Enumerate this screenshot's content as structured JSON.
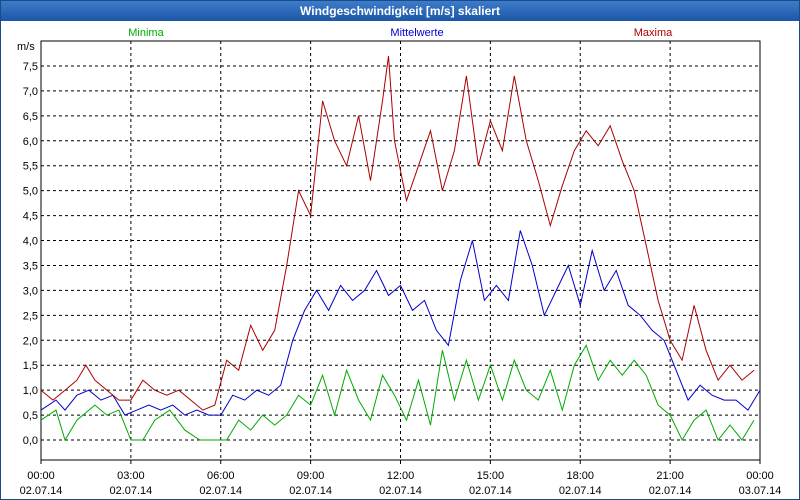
{
  "window": {
    "title": "Windgeschwindigkeit [m/s] skaliert"
  },
  "chart_data": {
    "type": "line",
    "title": "Windgeschwindigkeit [m/s] skaliert",
    "ylabel": "m/s",
    "ylim": [
      -0.4,
      8.0
    ],
    "xlim": [
      0,
      24
    ],
    "grid": true,
    "legend": "top",
    "y_ticks": [
      "0,0",
      "0,5",
      "1,0",
      "1,5",
      "2,0",
      "2,5",
      "3,0",
      "3,5",
      "4,0",
      "4,5",
      "5,0",
      "5,5",
      "6,0",
      "6,5",
      "7,0",
      "7,5"
    ],
    "x_tick_times": [
      "00:00",
      "03:00",
      "06:00",
      "09:00",
      "12:00",
      "15:00",
      "18:00",
      "21:00",
      "00:00"
    ],
    "x_tick_dates": [
      "02.07.14",
      "02.07.14",
      "02.07.14",
      "02.07.14",
      "02.07.14",
      "02.07.14",
      "02.07.14",
      "02.07.14",
      "03.07.14"
    ],
    "series": [
      {
        "name": "Minima",
        "color": "#00aa00",
        "points": [
          [
            0,
            0.4
          ],
          [
            0.5,
            0.6
          ],
          [
            0.8,
            0.0
          ],
          [
            1.2,
            0.4
          ],
          [
            1.8,
            0.7
          ],
          [
            2.2,
            0.5
          ],
          [
            2.6,
            0.6
          ],
          [
            3.0,
            0.0
          ],
          [
            3.4,
            0.0
          ],
          [
            3.8,
            0.4
          ],
          [
            4.3,
            0.6
          ],
          [
            4.8,
            0.2
          ],
          [
            5.3,
            0.0
          ],
          [
            5.8,
            0.0
          ],
          [
            6.2,
            0.0
          ],
          [
            6.6,
            0.4
          ],
          [
            7.0,
            0.2
          ],
          [
            7.4,
            0.5
          ],
          [
            7.8,
            0.3
          ],
          [
            8.2,
            0.5
          ],
          [
            8.6,
            0.9
          ],
          [
            9.0,
            0.7
          ],
          [
            9.4,
            1.3
          ],
          [
            9.8,
            0.5
          ],
          [
            10.2,
            1.4
          ],
          [
            10.6,
            0.8
          ],
          [
            11.0,
            0.4
          ],
          [
            11.4,
            1.3
          ],
          [
            11.8,
            0.9
          ],
          [
            12.2,
            0.4
          ],
          [
            12.6,
            1.2
          ],
          [
            13.0,
            0.3
          ],
          [
            13.4,
            1.8
          ],
          [
            13.8,
            0.8
          ],
          [
            14.2,
            1.6
          ],
          [
            14.6,
            0.8
          ],
          [
            15.0,
            1.5
          ],
          [
            15.4,
            0.8
          ],
          [
            15.8,
            1.6
          ],
          [
            16.2,
            1.0
          ],
          [
            16.6,
            0.8
          ],
          [
            17.0,
            1.4
          ],
          [
            17.4,
            0.6
          ],
          [
            17.8,
            1.5
          ],
          [
            18.2,
            1.9
          ],
          [
            18.6,
            1.2
          ],
          [
            19.0,
            1.6
          ],
          [
            19.4,
            1.3
          ],
          [
            19.8,
            1.6
          ],
          [
            20.2,
            1.3
          ],
          [
            20.6,
            0.7
          ],
          [
            21.0,
            0.5
          ],
          [
            21.4,
            0.0
          ],
          [
            21.8,
            0.4
          ],
          [
            22.2,
            0.6
          ],
          [
            22.6,
            0.0
          ],
          [
            23.0,
            0.3
          ],
          [
            23.4,
            0.0
          ],
          [
            23.8,
            0.4
          ]
        ]
      },
      {
        "name": "Mittelwerte",
        "color": "#0000cc",
        "points": [
          [
            0,
            0.6
          ],
          [
            0.5,
            0.8
          ],
          [
            0.8,
            0.6
          ],
          [
            1.2,
            0.9
          ],
          [
            1.6,
            1.0
          ],
          [
            2.0,
            0.8
          ],
          [
            2.4,
            0.9
          ],
          [
            2.8,
            0.5
          ],
          [
            3.2,
            0.6
          ],
          [
            3.6,
            0.7
          ],
          [
            4.0,
            0.6
          ],
          [
            4.4,
            0.7
          ],
          [
            4.8,
            0.5
          ],
          [
            5.2,
            0.6
          ],
          [
            5.6,
            0.5
          ],
          [
            6.0,
            0.5
          ],
          [
            6.4,
            0.9
          ],
          [
            6.8,
            0.8
          ],
          [
            7.2,
            1.0
          ],
          [
            7.6,
            0.9
          ],
          [
            8.0,
            1.1
          ],
          [
            8.4,
            2.0
          ],
          [
            8.8,
            2.6
          ],
          [
            9.2,
            3.0
          ],
          [
            9.6,
            2.6
          ],
          [
            10.0,
            3.1
          ],
          [
            10.4,
            2.8
          ],
          [
            10.8,
            3.0
          ],
          [
            11.2,
            3.4
          ],
          [
            11.6,
            2.9
          ],
          [
            12.0,
            3.1
          ],
          [
            12.4,
            2.6
          ],
          [
            12.8,
            2.8
          ],
          [
            13.2,
            2.2
          ],
          [
            13.6,
            1.9
          ],
          [
            14.0,
            3.2
          ],
          [
            14.4,
            4.0
          ],
          [
            14.8,
            2.8
          ],
          [
            15.2,
            3.1
          ],
          [
            15.6,
            2.8
          ],
          [
            16.0,
            4.2
          ],
          [
            16.4,
            3.5
          ],
          [
            16.8,
            2.5
          ],
          [
            17.2,
            3.0
          ],
          [
            17.6,
            3.5
          ],
          [
            18.0,
            2.7
          ],
          [
            18.4,
            3.8
          ],
          [
            18.8,
            3.0
          ],
          [
            19.2,
            3.4
          ],
          [
            19.6,
            2.7
          ],
          [
            20.0,
            2.5
          ],
          [
            20.4,
            2.2
          ],
          [
            20.8,
            2.0
          ],
          [
            21.2,
            1.4
          ],
          [
            21.6,
            0.8
          ],
          [
            22.0,
            1.1
          ],
          [
            22.4,
            0.9
          ],
          [
            22.8,
            0.8
          ],
          [
            23.2,
            0.8
          ],
          [
            23.6,
            0.6
          ],
          [
            24.0,
            1.0
          ]
        ]
      },
      {
        "name": "Maxima",
        "color": "#aa0000",
        "points": [
          [
            0,
            1.0
          ],
          [
            0.4,
            0.8
          ],
          [
            0.8,
            1.0
          ],
          [
            1.2,
            1.2
          ],
          [
            1.5,
            1.5
          ],
          [
            1.8,
            1.2
          ],
          [
            2.2,
            1.0
          ],
          [
            2.6,
            0.8
          ],
          [
            3.0,
            0.8
          ],
          [
            3.4,
            1.2
          ],
          [
            3.8,
            1.0
          ],
          [
            4.2,
            0.9
          ],
          [
            4.6,
            1.0
          ],
          [
            5.0,
            0.8
          ],
          [
            5.4,
            0.6
          ],
          [
            5.8,
            0.7
          ],
          [
            6.2,
            1.6
          ],
          [
            6.6,
            1.4
          ],
          [
            7.0,
            2.3
          ],
          [
            7.4,
            1.8
          ],
          [
            7.8,
            2.2
          ],
          [
            8.2,
            3.5
          ],
          [
            8.6,
            5.0
          ],
          [
            9.0,
            4.5
          ],
          [
            9.4,
            6.8
          ],
          [
            9.8,
            6.0
          ],
          [
            10.2,
            5.5
          ],
          [
            10.6,
            6.5
          ],
          [
            11.0,
            5.2
          ],
          [
            11.4,
            6.8
          ],
          [
            11.6,
            7.7
          ],
          [
            11.8,
            6.0
          ],
          [
            12.2,
            4.8
          ],
          [
            12.6,
            5.5
          ],
          [
            13.0,
            6.2
          ],
          [
            13.4,
            5.0
          ],
          [
            13.8,
            5.8
          ],
          [
            14.2,
            7.3
          ],
          [
            14.6,
            5.5
          ],
          [
            15.0,
            6.4
          ],
          [
            15.4,
            5.8
          ],
          [
            15.8,
            7.3
          ],
          [
            16.2,
            6.0
          ],
          [
            16.6,
            5.2
          ],
          [
            17.0,
            4.3
          ],
          [
            17.4,
            5.1
          ],
          [
            17.8,
            5.8
          ],
          [
            18.2,
            6.2
          ],
          [
            18.6,
            5.9
          ],
          [
            19.0,
            6.3
          ],
          [
            19.4,
            5.6
          ],
          [
            19.8,
            5.0
          ],
          [
            20.2,
            3.9
          ],
          [
            20.6,
            2.8
          ],
          [
            21.0,
            2.0
          ],
          [
            21.4,
            1.6
          ],
          [
            21.8,
            2.7
          ],
          [
            22.2,
            1.8
          ],
          [
            22.6,
            1.2
          ],
          [
            23.0,
            1.5
          ],
          [
            23.4,
            1.2
          ],
          [
            23.8,
            1.4
          ]
        ]
      }
    ]
  }
}
